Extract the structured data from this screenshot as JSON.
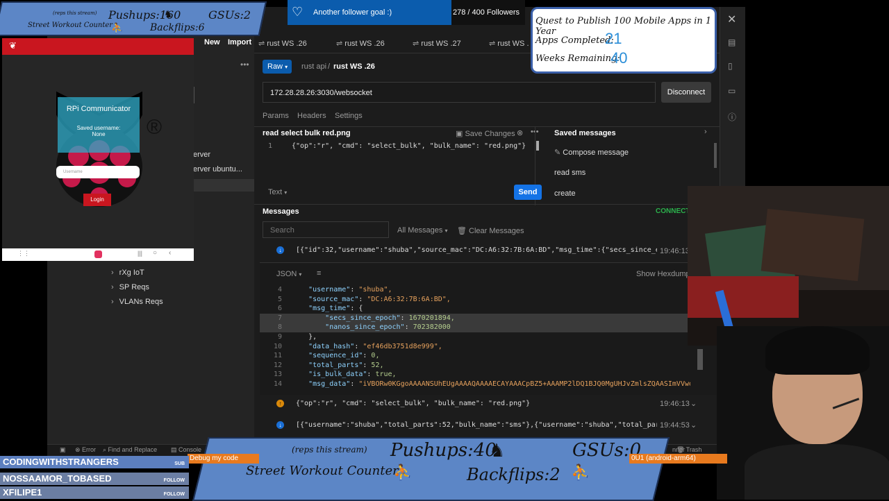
{
  "app": {
    "tabs": [
      "rust WS .26",
      "rust WS .26",
      "rust WS .27",
      "rust WS ."
    ],
    "new_label": "New",
    "import_label": "Import",
    "sidebar_items": [
      "erver",
      "erver ubuntu...",
      "rXg IoT",
      "SP Reqs",
      "VLANs Reqs"
    ],
    "request": {
      "mode": "Raw",
      "breadcrumb_parent": "rust api",
      "breadcrumb_sep": "/",
      "name": "rust WS .26",
      "url": "172.28.28.26:3030/websocket",
      "disconnect_label": "Disconnect",
      "subtabs": [
        "Params",
        "Headers",
        "Settings"
      ]
    },
    "message_editor": {
      "title": "read select bulk red.png",
      "save_changes": "Save Changes",
      "line_no": "1",
      "line": "{\"op\":\"r\", \"cmd\": \"select_bulk\", \"bulk_name\": \"red.png\"}",
      "format": "Text",
      "send_label": "Send"
    },
    "saved_messages": {
      "title": "Saved messages",
      "compose": "Compose message",
      "items": [
        "read sms",
        "create"
      ]
    },
    "messages": {
      "title": "Messages",
      "status": "CONNECTE",
      "search_placeholder": "Search",
      "filter": "All Messages",
      "clear": "Clear Messages",
      "row1_text": "[{\"id\":32,\"username\":\"shuba\",\"source_mac\":\"DC:A6:32:7B:6A:BD\",\"msg_time\":{\"secs_since_ep...",
      "row1_time": "19:46:13",
      "view_format": "JSON",
      "show_hexdump": "Show Hexdump",
      "json_lines": [
        {
          "n": "4",
          "k": "\"username\"",
          "v": "\"shuba\","
        },
        {
          "n": "5",
          "k": "\"source_mac\"",
          "v": "\"DC:A6:32:7B:6A:BD\","
        },
        {
          "n": "6",
          "k": "\"msg_time\"",
          "v": ": {"
        },
        {
          "n": "7",
          "k": "\"secs_since_epoch\"",
          "v": "1670201894,"
        },
        {
          "n": "8",
          "k": "\"nanos_since_epoch\"",
          "v": "702382000"
        },
        {
          "n": "9",
          "k": "},",
          "v": ""
        },
        {
          "n": "10",
          "k": "\"data_hash\"",
          "v": "\"ef46db3751d8e999\","
        },
        {
          "n": "11",
          "k": "\"sequence_id\"",
          "v": "0,"
        },
        {
          "n": "12",
          "k": "\"total_parts\"",
          "v": "52,"
        },
        {
          "n": "13",
          "k": "\"is_bulk_data\"",
          "v": "true,"
        },
        {
          "n": "14",
          "k": "\"msg_data\"",
          "v": "\"iVBORw0KGgoAAAANSUhEUgAAAAQAAAAECAYAAACpBZ5+AAAMP2lDQ1BJQ0MgUHJvZmlsZQAASImVVwdYUBkWnluS"
        }
      ],
      "row2_text": "{\"op\":\"r\", \"cmd\": \"select_bulk\", \"bulk_name\": \"red.png\"}",
      "row2_time": "19:46:13",
      "row3_text": "[{\"username\":\"shuba\",\"total_parts\":52,\"bulk_name\":\"sms\"},{\"username\":\"shuba\",\"total_part...",
      "row3_time": "19:44:53"
    },
    "statusbar": {
      "error": "Error",
      "find": "Find and Replace",
      "console": "Console",
      "trash": "Trash",
      "runner": "nner"
    }
  },
  "phone": {
    "app_title": "RPi Communicator",
    "saved_label": "Saved username:",
    "saved_value": "None",
    "username_placeholder": "Username",
    "login_label": "Login",
    "registered": "®"
  },
  "overlays": {
    "follower_goal": "Another follower goal :)",
    "follower_count": "278 / 400 Followers",
    "quest_title": "Quest to Publish 100 Mobile Apps in 1 Year",
    "apps_label": "Apps Completed:",
    "apps_value": "21",
    "weeks_label": "Weeks Remaining:",
    "weeks_value": "40",
    "small_counter": {
      "reps": "(reps this stream)",
      "title": "Street Workout Counter",
      "pushups": "Pushups:160",
      "gsus": "GSUs:2",
      "backflips": "Backflips:6"
    },
    "big_counter": {
      "reps": "(reps this stream)",
      "title": "Street Workout Counter",
      "pushups": "Pushups:40",
      "gsus": "GSUs:0",
      "backflips": "Backflips:2"
    },
    "debug_label": "Debug my code",
    "device_label": "0U1 (android-arm64)",
    "chat": [
      {
        "name": "CODINGWITHSTRANGERS",
        "tag": "SUB"
      },
      {
        "name": "NOSSAAMOR_TOBASED",
        "tag": "FOLLOW"
      },
      {
        "name": "XFILIPE1",
        "tag": "FOLLOW"
      }
    ]
  },
  "colors": {
    "accent_blue": "#0b5cad",
    "send_blue": "#1473e6",
    "connected_green": "#2bb24c",
    "banner_blue": "#5c86c6",
    "raspberry_red": "#c51a4a"
  }
}
